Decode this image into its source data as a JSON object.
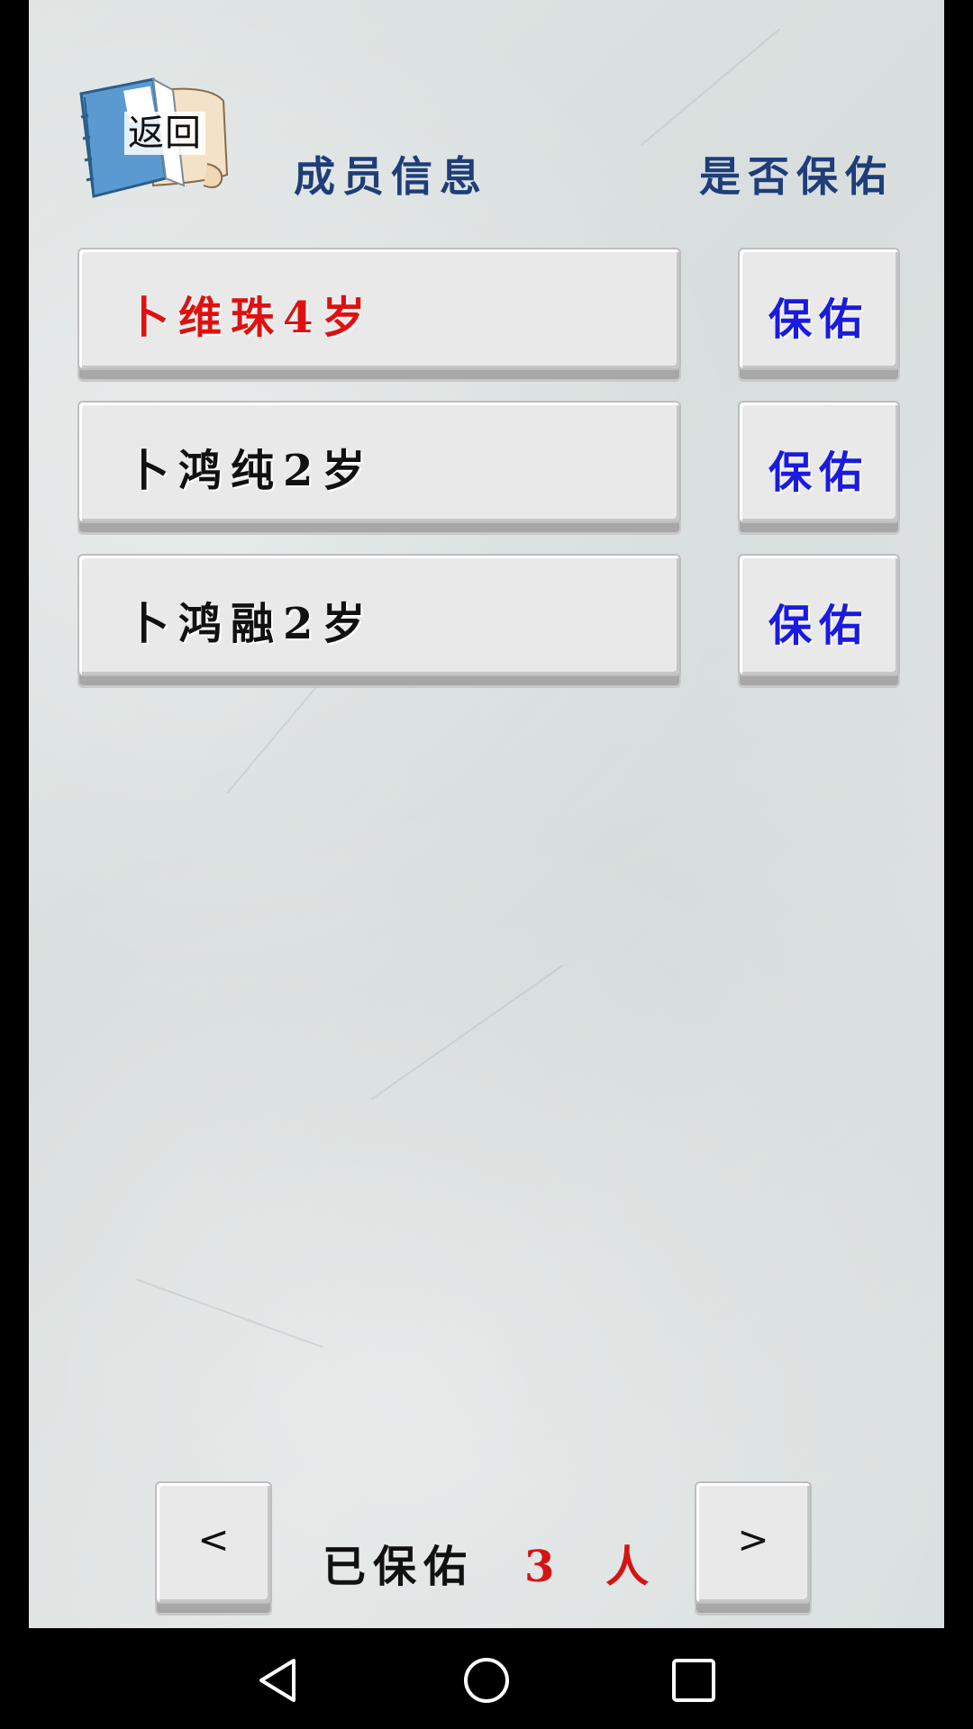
{
  "back_button": {
    "label": "返回"
  },
  "header": {
    "member_info": "成员信息",
    "protect_question": "是否保佑"
  },
  "members": [
    {
      "name": "卜维珠4岁",
      "action": "保佑",
      "selected": true
    },
    {
      "name": "卜鸿纯2岁",
      "action": "保佑",
      "selected": false
    },
    {
      "name": "卜鸿融2岁",
      "action": "保佑",
      "selected": false
    }
  ],
  "footer": {
    "prev_label": "<",
    "next_label": ">",
    "protected_label": "已保佑",
    "protected_count": "3 人"
  },
  "navbar": {
    "icons": [
      "back-triangle-icon",
      "home-circle-icon",
      "recents-square-icon"
    ]
  },
  "colors": {
    "header_text": "#1f3d78",
    "selected_name": "#e01010",
    "protect_label": "#1a1ae0",
    "count": "#d41414"
  }
}
